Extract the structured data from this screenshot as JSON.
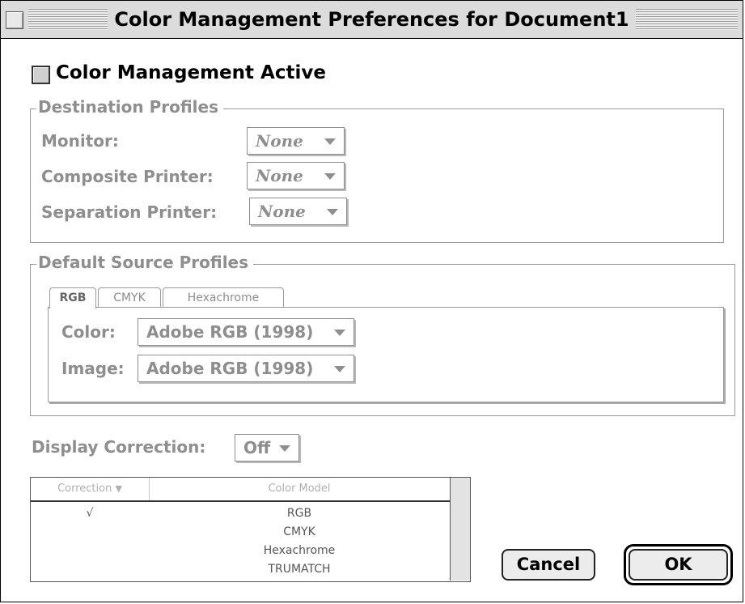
{
  "window": {
    "title": "Color Management Preferences for Document1"
  },
  "color_management": {
    "active_label": "Color Management Active",
    "checked": false
  },
  "destination_profiles": {
    "title": "Destination Profiles",
    "rows": [
      {
        "label": "Monitor:",
        "value": "None"
      },
      {
        "label": "Composite Printer:",
        "value": "None"
      },
      {
        "label": "Separation Printer:",
        "value": "None"
      }
    ]
  },
  "default_source_profiles": {
    "title": "Default Source Profiles",
    "tabs": [
      "RGB",
      "CMYK",
      "Hexachrome"
    ],
    "active_tab": "RGB",
    "rows": [
      {
        "label": "Color:",
        "value": "Adobe RGB (1998)"
      },
      {
        "label": "Image:",
        "value": "Adobe RGB (1998)"
      }
    ]
  },
  "display_correction": {
    "label": "Display Correction:",
    "value": "Off"
  },
  "correction_table": {
    "columns": [
      "Correction",
      "Color Model"
    ],
    "rows": [
      {
        "check": "√",
        "model": "RGB"
      },
      {
        "check": "",
        "model": "CMYK"
      },
      {
        "check": "",
        "model": "Hexachrome"
      },
      {
        "check": "",
        "model": "TRUMATCH"
      }
    ]
  },
  "buttons": {
    "cancel": "Cancel",
    "ok": "OK"
  },
  "colors": {
    "disabled_text": "#8e8e8e",
    "title_bar": "#dcdcdc",
    "button_face": "#ececec"
  }
}
